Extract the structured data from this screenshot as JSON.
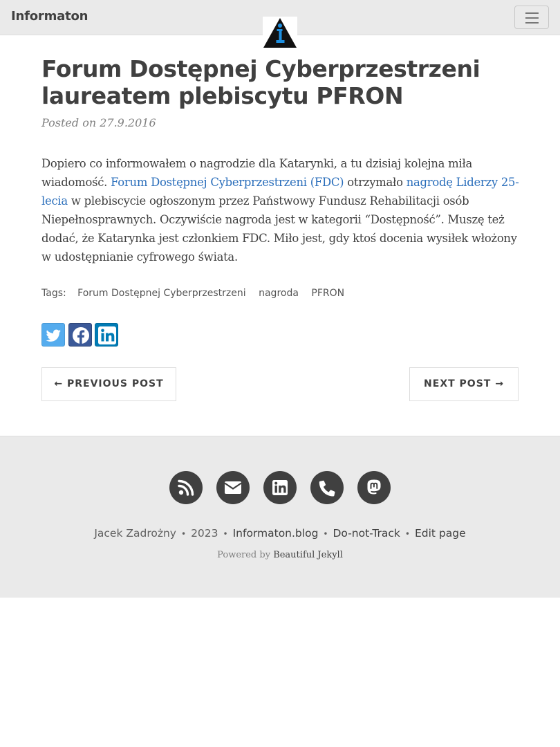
{
  "navbar": {
    "brand": "Informaton",
    "logo_icon": "info-triangle-logo",
    "menu_icon": "hamburger-icon"
  },
  "post": {
    "title": "Forum Dostępnej Cyberprzestrzeni laureatem plebiscytu PFRON",
    "posted_on": "Posted on 27.9.2016",
    "body": {
      "text_1": "Dopiero co informowałem o nagrodzie dla Katarynki, a tu dzisiaj kolejna miła wiadomość. ",
      "link_1": "Forum Dostępnej Cyberprzestrzeni (FDC)",
      "text_2": " otrzymało ",
      "link_2": "nagrodę Liderzy 25-lecia",
      "text_3": " w plebiscycie ogłoszonym przez Państwowy Fundusz Rehabilitacji osób Niepełnosprawnych. Oczywiście nagroda jest w kategorii “Dostępność”. Muszę też dodać, że Katarynka jest członkiem FDC. Miło jest, gdy ktoś docenia wysiłek włożony w udostępnianie cyfrowego świata."
    },
    "tags_label": "Tags:",
    "tags": [
      "Forum Dostępnej Cyberprzestrzeni",
      "nagroda",
      "PFRON"
    ]
  },
  "share": {
    "icons": [
      "twitter-icon",
      "facebook-icon",
      "linkedin-icon"
    ],
    "colors": {
      "twitter": "#55acee",
      "facebook": "#3b5998",
      "linkedin": "#007bb5"
    }
  },
  "pager": {
    "previous": "← PREVIOUS POST",
    "next": "NEXT POST →"
  },
  "footer": {
    "icons": [
      "rss-icon",
      "envelope-icon",
      "linkedin-icon",
      "phone-icon",
      "mastodon-icon"
    ],
    "author": "Jacek Zadrożny",
    "separator": "•",
    "year": "2023",
    "site": "Informaton.blog",
    "dnt": "Do-not-Track",
    "edit": "Edit page",
    "powered_by": "Powered by",
    "theme": "Beautiful Jekyll"
  }
}
